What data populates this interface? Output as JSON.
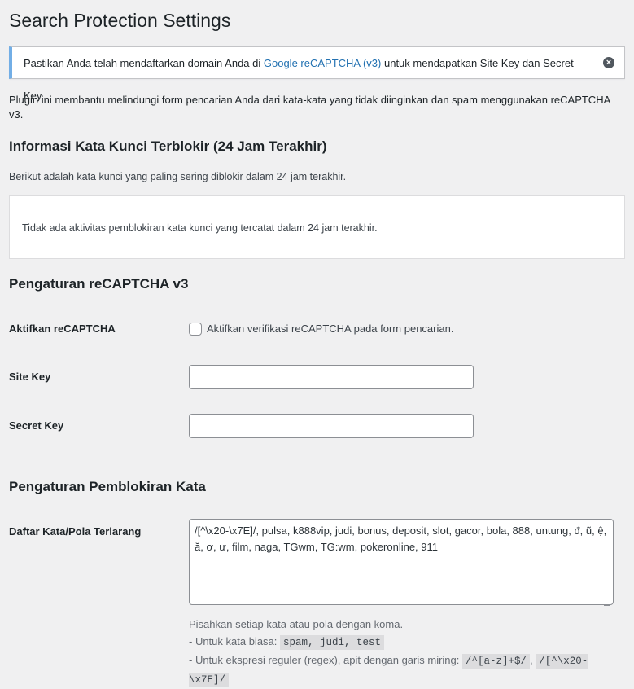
{
  "page": {
    "title": "Search Protection Settings"
  },
  "notice": {
    "text_before": "Pastikan Anda telah mendaftarkan domain Anda di ",
    "link_text": "Google reCAPTCHA (v3)",
    "text_after": " untuk mendapatkan Site Key dan Secret Key.",
    "dismiss_glyph": "×"
  },
  "intro": "Plugin ini membantu melindungi form pencarian Anda dari kata-kata yang tidak diinginkan dan spam menggunakan reCAPTCHA v3.",
  "blocked_section": {
    "heading": "Informasi Kata Kunci Terblokir (24 Jam Terakhir)",
    "description": "Berikut adalah kata kunci yang paling sering diblokir dalam 24 jam terakhir.",
    "empty_message": "Tidak ada aktivitas pemblokiran kata kunci yang tercatat dalam 24 jam terakhir."
  },
  "recaptcha_section": {
    "heading": "Pengaturan reCAPTCHA v3",
    "enable_label": "Aktifkan reCAPTCHA",
    "enable_checkbox_label": "Aktifkan verifikasi reCAPTCHA pada form pencarian.",
    "enable_checked": false,
    "site_key_label": "Site Key",
    "site_key_value": "",
    "secret_key_label": "Secret Key",
    "secret_key_value": ""
  },
  "word_block_section": {
    "heading": "Pengaturan Pemblokiran Kata",
    "list_label": "Daftar Kata/Pola Terlarang",
    "list_value": "/[^\\x20-\\x7E]/, pulsa, k888vip, judi, bonus, deposit, slot, gacor, bola, 888, untung, đ, ũ, ệ, ă, ơ, ư, film, naga, TGwm, TG:wm, pokeronline, 911",
    "help_line1": "Pisahkan setiap kata atau pola dengan koma.",
    "help_line2_text": "- Untuk kata biasa: ",
    "help_line2_code": "spam, judi, test",
    "help_line3_text": "- Untuk ekspresi reguler (regex), apit dengan garis miring: ",
    "help_line3_code1": "/^[a-z]+$/",
    "help_line3_sep": ", ",
    "help_line3_code2": "/[^\\x20-\\x7E]/"
  }
}
